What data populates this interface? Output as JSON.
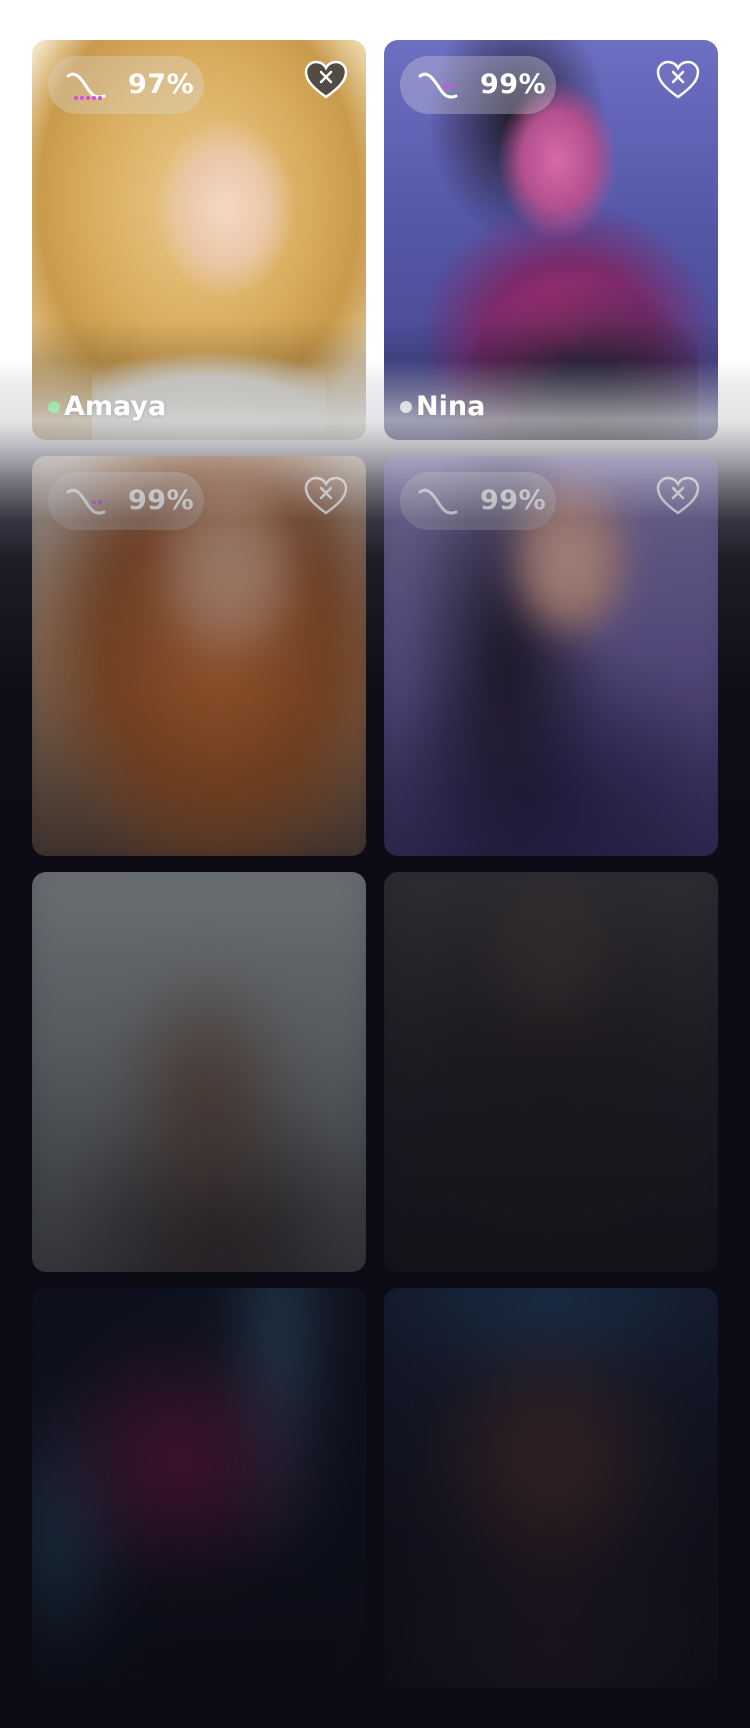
{
  "theme": {
    "online_color": "#5fd36a",
    "offline_color": "#c9c9cf",
    "pill_dot_color": "#cf4fe0"
  },
  "cards": [
    {
      "name": "Amaya",
      "match": "97%",
      "status": "online",
      "heart_icon": "heart-remove-icon"
    },
    {
      "name": "Nina",
      "match": "99%",
      "status": "offline",
      "heart_icon": "heart-remove-icon"
    },
    {
      "name": "",
      "match": "99%",
      "status": "",
      "heart_icon": "heart-remove-icon"
    },
    {
      "name": "",
      "match": "99%",
      "status": "",
      "heart_icon": "heart-remove-icon"
    },
    {
      "name": "",
      "match": "",
      "status": ""
    },
    {
      "name": "",
      "match": "",
      "status": ""
    },
    {
      "name": "",
      "match": "",
      "status": ""
    },
    {
      "name": "",
      "match": "",
      "status": ""
    }
  ]
}
